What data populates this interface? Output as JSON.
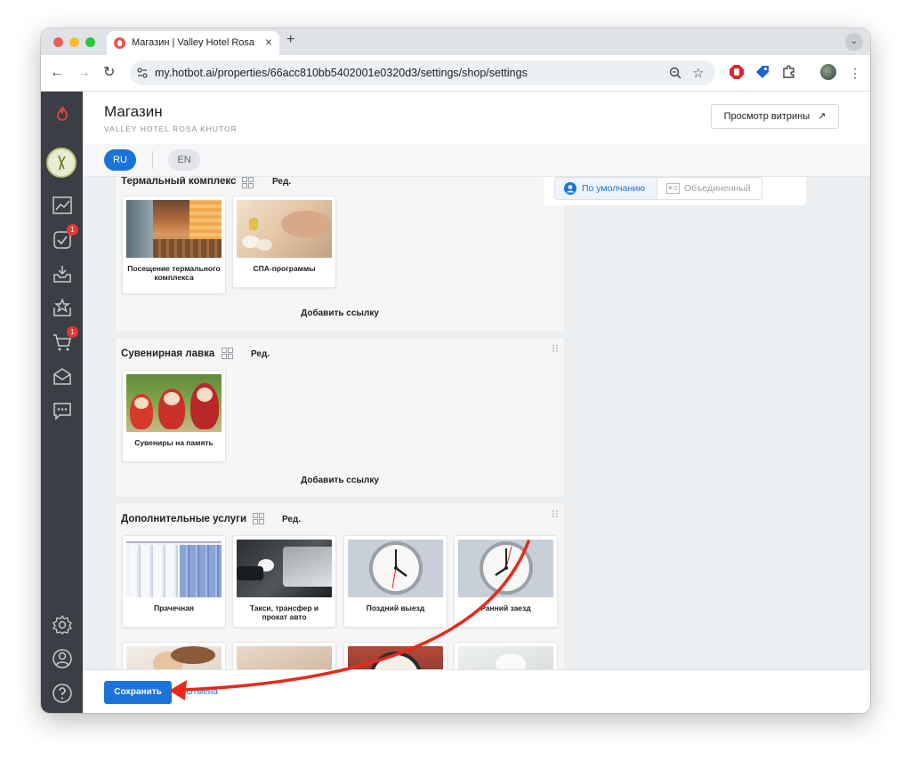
{
  "browser": {
    "tab_title": "Магазин | Valley Hotel Rosa Khutor",
    "url": "my.hotbot.ai/properties/66acc810bb5402001e0320d3/settings/shop/settings"
  },
  "header": {
    "title": "Магазин",
    "subtitle": "VALLEY HOTEL ROSA KHUTOR",
    "preview_button": "Просмотр витрины",
    "preview_arrow": "↗"
  },
  "languages": [
    "RU",
    "EN"
  ],
  "sidebar": {
    "badges": {
      "tasks": "1",
      "cart": "1"
    }
  },
  "sections": [
    {
      "title": "Термальный комплекс",
      "edit_label": "Ред.",
      "add_link_label": "Добавить ссылку",
      "cards": [
        {
          "label": "Посещение термального комплекса",
          "icon": "sauna-image"
        },
        {
          "label": "СПА-программы",
          "icon": "spa-image"
        }
      ]
    },
    {
      "title": "Сувенирная лавка",
      "edit_label": "Ред.",
      "add_link_label": "Добавить ссылку",
      "cards": [
        {
          "label": "Сувениры на память",
          "icon": "matryoshka-image"
        }
      ]
    },
    {
      "title": "Дополнительные услуги",
      "edit_label": "Ред.",
      "cards": [
        {
          "label": "Прачечная",
          "icon": "laundry-image"
        },
        {
          "label": "Такси, трансфер и прокат авто",
          "icon": "car-image"
        },
        {
          "label": "Поздний выезд",
          "icon": "clock-image"
        },
        {
          "label": "Ранний заезд",
          "icon": "clock-image"
        }
      ]
    }
  ],
  "right_panel": {
    "tabs": [
      "По умолчанию",
      "Объединенный"
    ]
  },
  "footer": {
    "save_label": "Сохранить",
    "cancel_label": "Отмена"
  },
  "colors": {
    "accent": "#1a73d8",
    "sidebar": "#3b3e44",
    "annotation_arrow": "#e8291c"
  }
}
